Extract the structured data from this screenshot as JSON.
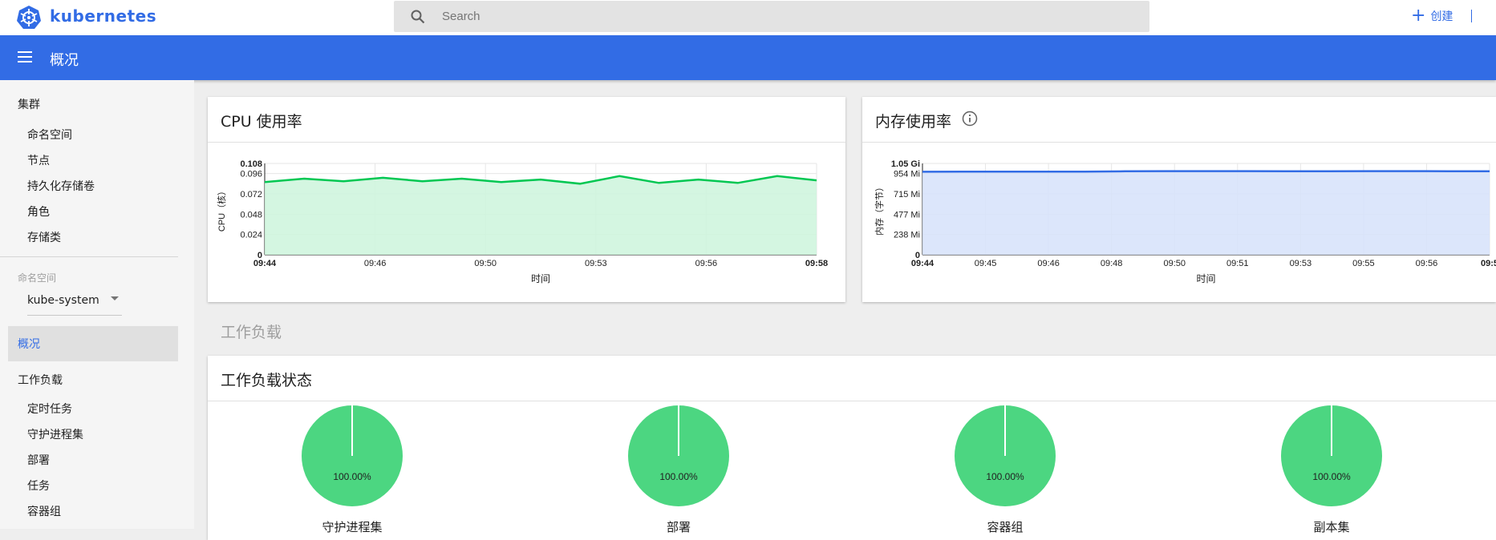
{
  "topbar": {
    "brand": "kubernetes",
    "search_placeholder": "Search",
    "create_label": "创建"
  },
  "header": {
    "title": "概况"
  },
  "sidebar": {
    "cluster_heading": "集群",
    "cluster_items": [
      "命名空间",
      "节点",
      "持久化存储卷",
      "角色",
      "存储类"
    ],
    "namespace_label": "命名空间",
    "namespace_value": "kube-system",
    "active_item": "概况",
    "workload_heading": "工作负载",
    "workload_items": [
      "定时任务",
      "守护进程集",
      "部署",
      "任务",
      "容器组"
    ]
  },
  "main": {
    "section_title": "工作负载",
    "status_card_title": "工作负载状态"
  },
  "colors": {
    "brand": "#326ce5",
    "cpu_line": "#00c752",
    "cpu_fill": "#ccf4dc",
    "mem_line": "#326ce5",
    "mem_fill": "#d6e2fa",
    "pie_green": "#4cd681"
  },
  "chart_data": [
    {
      "type": "area",
      "title": "CPU 使用率",
      "xlabel": "时间",
      "ylabel": "CPU（核）",
      "x_ticks": [
        "09:44",
        "09:46",
        "09:50",
        "09:53",
        "09:56",
        "09:58"
      ],
      "y_ticks": [
        "0",
        "0.024",
        "0.048",
        "0.072",
        "0.096",
        "0.108"
      ],
      "ylim": [
        0,
        0.108
      ],
      "series": [
        {
          "values": [
            0.086,
            0.09,
            0.087,
            0.091,
            0.087,
            0.09,
            0.086,
            0.089,
            0.084,
            0.093,
            0.085,
            0.089,
            0.085,
            0.093,
            0.088
          ]
        }
      ]
    },
    {
      "type": "area",
      "title": "内存使用率",
      "xlabel": "时间",
      "ylabel": "内存（字节）",
      "x_ticks": [
        "09:44",
        "09:45",
        "09:46",
        "09:48",
        "09:50",
        "09:51",
        "09:53",
        "09:55",
        "09:56",
        "09:5"
      ],
      "y_ticks": [
        "0",
        "238 Mi",
        "477 Mi",
        "715 Mi",
        "954 Mi",
        "1.05 Gi"
      ],
      "ylim": [
        0,
        1.05
      ],
      "series": [
        {
          "values": [
            0.954,
            0.955,
            0.955,
            0.956,
            0.956,
            0.96,
            0.962,
            0.962,
            0.962,
            0.961,
            0.961,
            0.962,
            0.962,
            0.961,
            0.96
          ]
        }
      ]
    },
    {
      "type": "pie",
      "charts": [
        {
          "label": "守护进程集",
          "percent": "100.00%",
          "value": 100
        },
        {
          "label": "部署",
          "percent": "100.00%",
          "value": 100
        },
        {
          "label": "容器组",
          "percent": "100.00%",
          "value": 100
        },
        {
          "label": "副本集",
          "percent": "100.00%",
          "value": 100
        }
      ]
    }
  ]
}
